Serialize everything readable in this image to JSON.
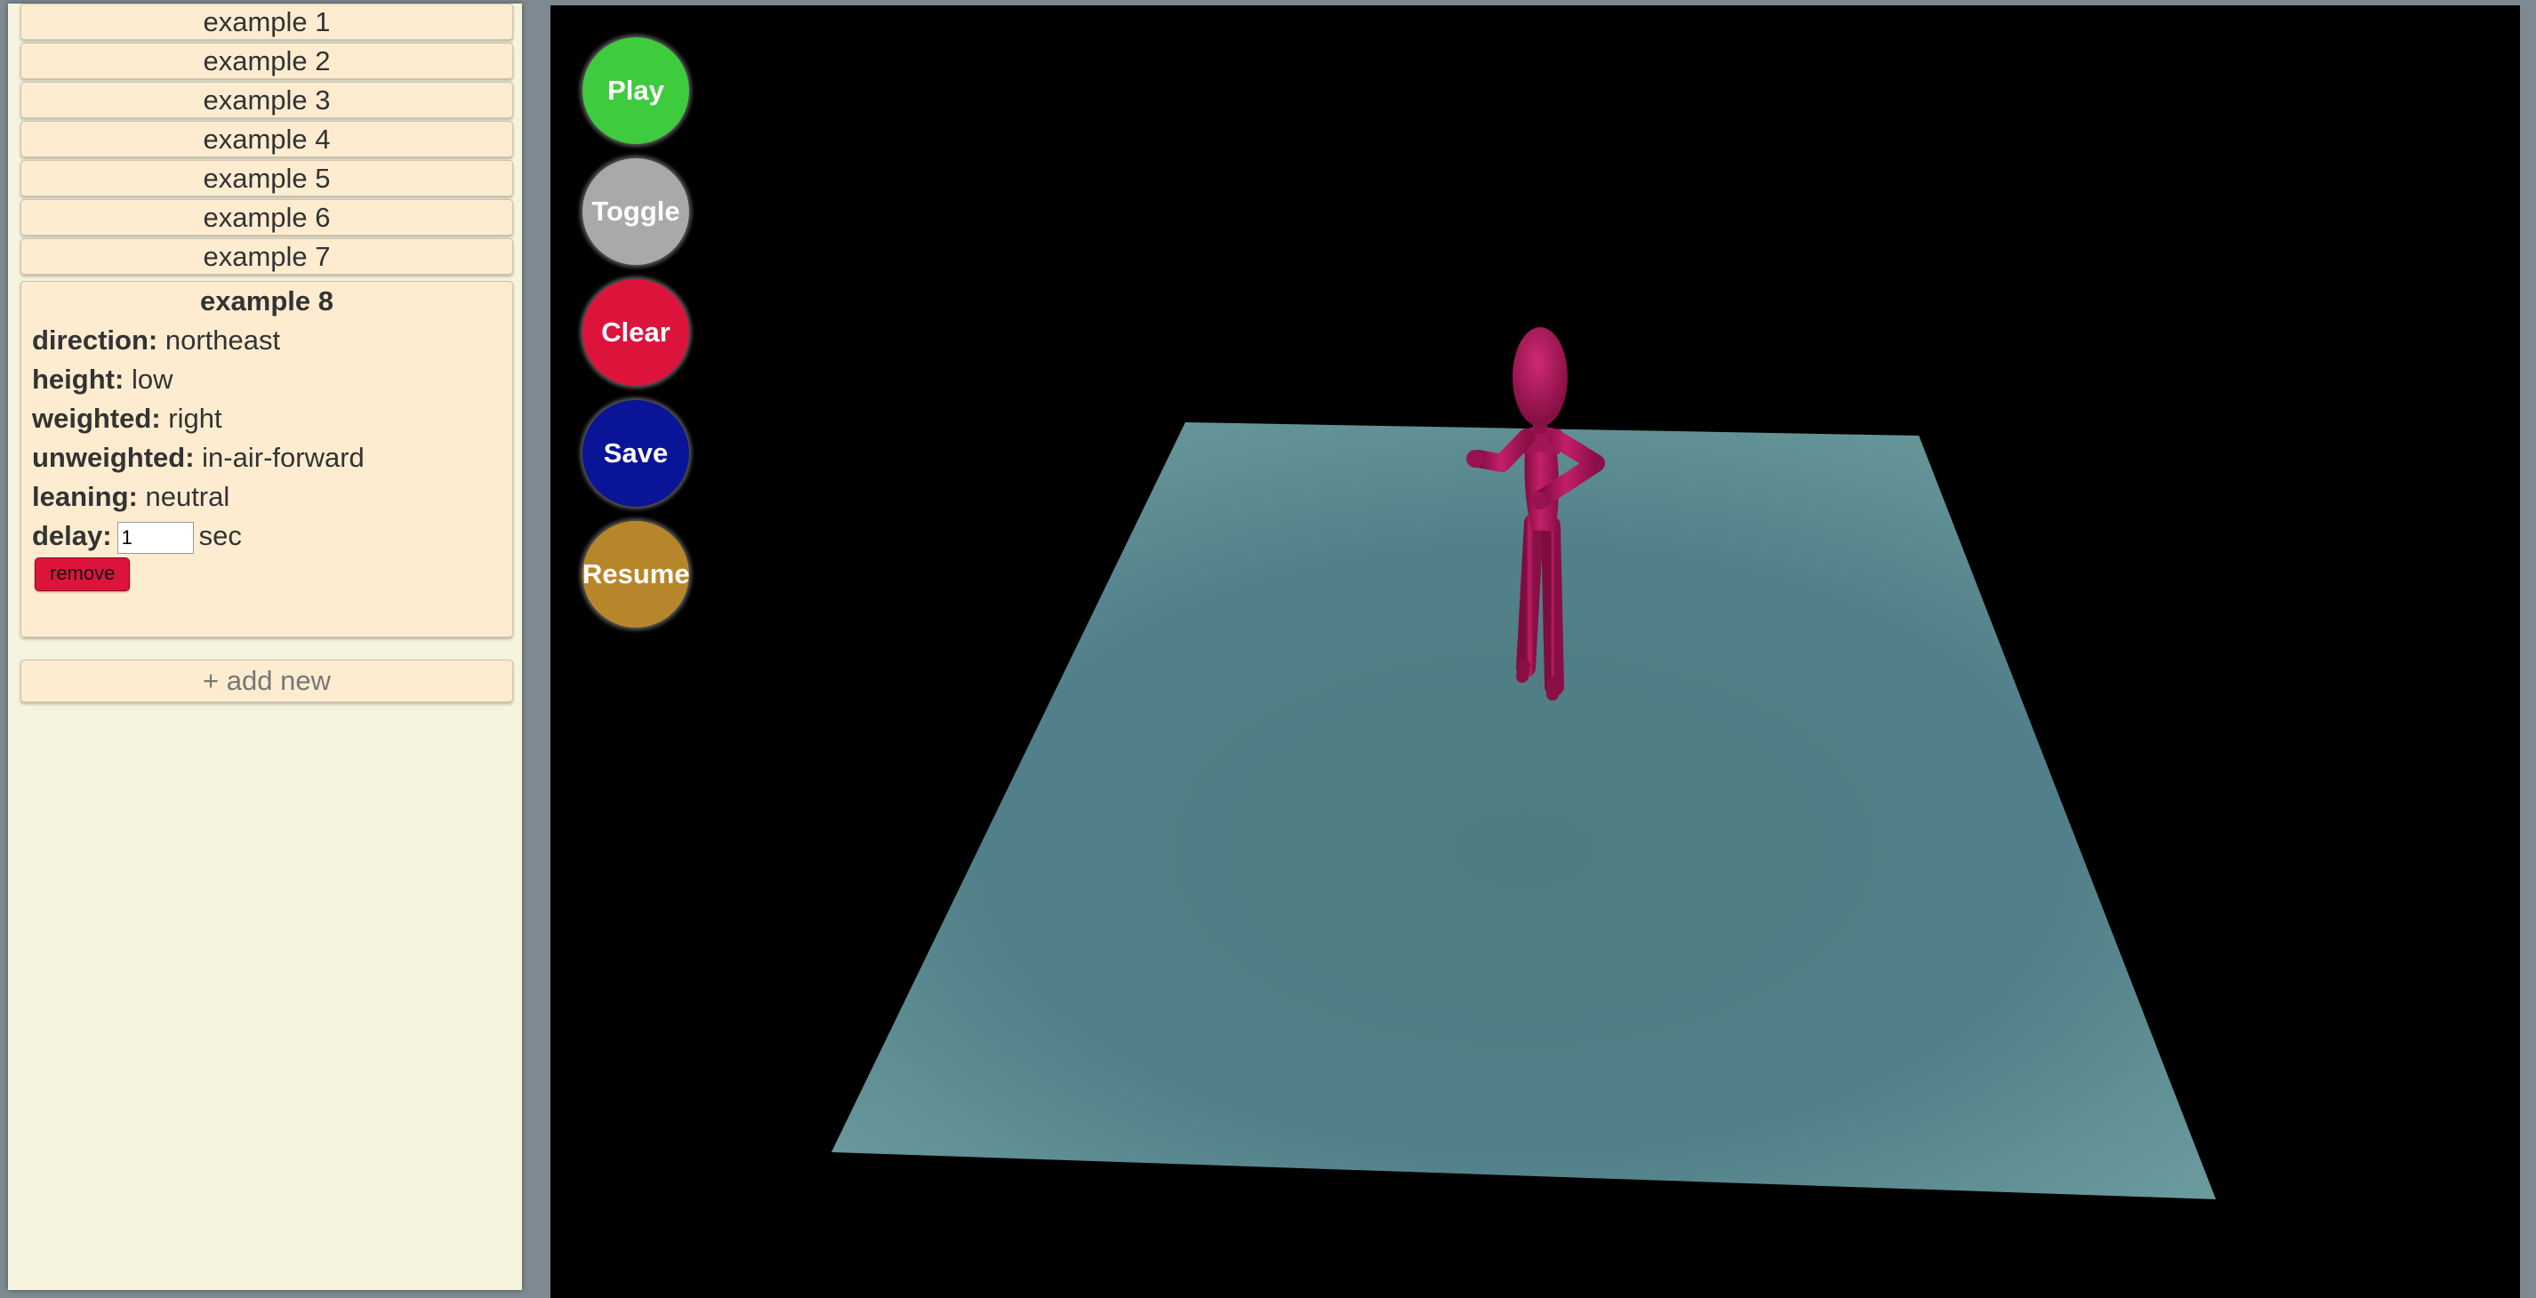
{
  "sidebar": {
    "examples": [
      {
        "label": "example 1"
      },
      {
        "label": "example 2"
      },
      {
        "label": "example 3"
      },
      {
        "label": "example 4"
      },
      {
        "label": "example 5"
      },
      {
        "label": "example 6"
      },
      {
        "label": "example 7"
      }
    ],
    "expanded": {
      "title": "example 8",
      "fields": {
        "direction": {
          "label": "direction:",
          "value": "northeast"
        },
        "height": {
          "label": "height:",
          "value": "low"
        },
        "weighted": {
          "label": "weighted:",
          "value": "right"
        },
        "unweighted": {
          "label": "unweighted:",
          "value": "in-air-forward"
        },
        "leaning": {
          "label": "leaning:",
          "value": "neutral"
        },
        "delay": {
          "label": "delay:",
          "value": "1",
          "unit": "sec"
        }
      },
      "remove_label": "remove"
    },
    "add_new_label": "+ add new"
  },
  "controls": {
    "play": {
      "label": "Play",
      "color": "#3ecb3e"
    },
    "toggle": {
      "label": "Toggle",
      "color": "#a9a9a9"
    },
    "clear": {
      "label": "Clear",
      "color": "#dc143c"
    },
    "save": {
      "label": "Save",
      "color": "#0a1496"
    },
    "resume": {
      "label": "Resume",
      "color": "#b8862a"
    }
  },
  "scene": {
    "floor_color": "#5a8a8e",
    "figure_color": "#b0185e",
    "background": "#000000"
  }
}
